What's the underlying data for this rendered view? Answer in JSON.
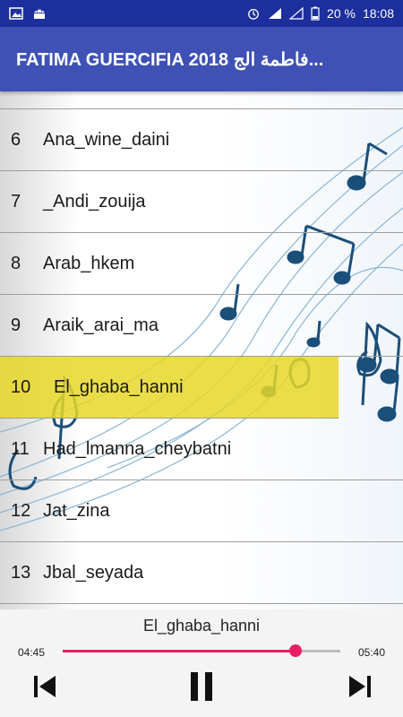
{
  "status_bar": {
    "battery": "20 %",
    "time": "18:08",
    "icons": [
      "image-icon",
      "android-icon",
      "alarm-icon",
      "signal-icon",
      "battery-icon"
    ]
  },
  "app_bar": {
    "title": "FATIMA GUERCIFIA 2018 فاطمة الج..."
  },
  "playlist": [
    {
      "num": "6",
      "title": "Ana_wine_daini"
    },
    {
      "num": "7",
      "title": "_Andi_zouija"
    },
    {
      "num": "8",
      "title": "Arab_hkem"
    },
    {
      "num": "9",
      "title": "Araik_arai_ma"
    },
    {
      "num": "10",
      "title": "El_ghaba_hanni"
    },
    {
      "num": "11",
      "title": "Had_lmanna_cheybatni"
    },
    {
      "num": "12",
      "title": "Jat_zina"
    },
    {
      "num": "13",
      "title": "Jbal_seyada"
    }
  ],
  "active_index": 4,
  "player": {
    "track": "El_ghaba_hanni",
    "current_time": "04:45",
    "total_time": "05:40",
    "progress": 0.838
  },
  "colors": {
    "status_bar": "#1c2f9c",
    "app_bar": "#3f51b5",
    "active_row": "#e6d728",
    "seek_accent": "#e91e63",
    "music_art": "#1a4f7a"
  }
}
